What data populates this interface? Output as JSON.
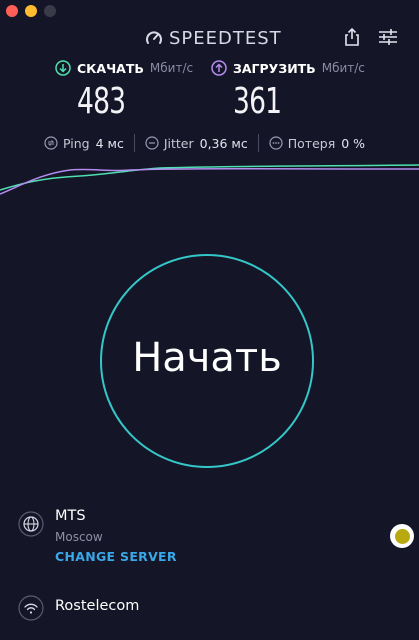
{
  "app": {
    "title": "SPEEDTEST"
  },
  "download": {
    "label": "СКАЧАТЬ",
    "unit": "Мбит/с",
    "value": "483"
  },
  "upload": {
    "label": "ЗАГРУЗИТЬ",
    "unit": "Мбит/с",
    "value": "361"
  },
  "stats": {
    "ping": {
      "label": "Ping",
      "value": "4 мс"
    },
    "jitter": {
      "label": "Jitter",
      "value": "0,36 мс"
    },
    "loss": {
      "label": "Потеря",
      "value": "0 %"
    }
  },
  "start_button": {
    "label": "Начать"
  },
  "server": {
    "name": "MTS",
    "city": "Moscow",
    "change_label": "CHANGE SERVER"
  },
  "isp": {
    "name": "Rostelecom"
  },
  "colors": {
    "background": "#141526",
    "download": "#4fe0b0",
    "upload": "#b48cf0",
    "ring": "#35c6c8",
    "link": "#3aa7e6"
  },
  "icons": {
    "logo": "speedometer-icon",
    "share": "share-icon",
    "settings": "sliders-icon",
    "download": "arrow-down-circle-icon",
    "upload": "arrow-up-circle-icon",
    "ping": "ping-icon",
    "jitter": "jitter-icon",
    "loss": "loss-icon",
    "server": "globe-icon",
    "isp": "wifi-icon"
  }
}
